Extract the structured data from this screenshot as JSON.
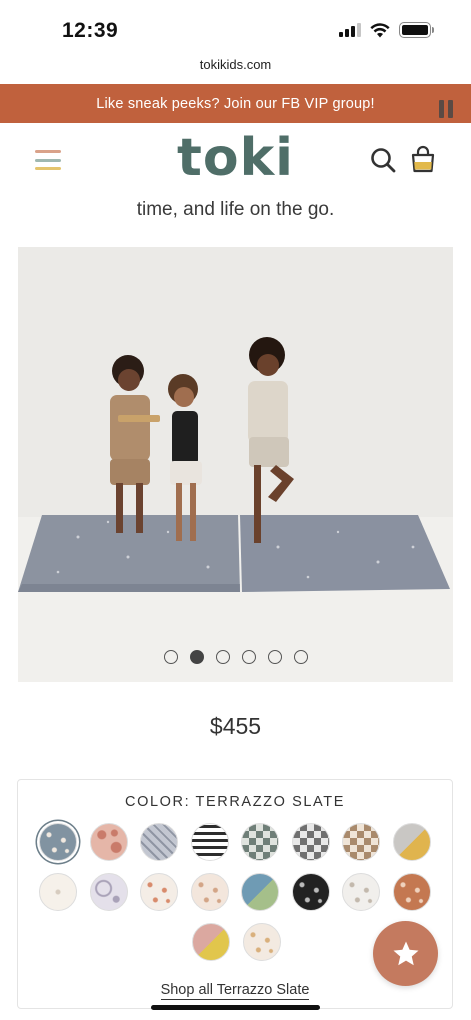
{
  "status": {
    "time": "12:39"
  },
  "browser": {
    "url": "tokikids.com"
  },
  "promo": {
    "text": "Like sneak peeks? Join our FB VIP group!"
  },
  "header": {
    "logo": "toki"
  },
  "tagline": "time, and life on the go.",
  "carousel": {
    "slide_count": 6,
    "active_index": 1
  },
  "product": {
    "price": "$455"
  },
  "color_panel": {
    "heading": "COLOR: TERRAZZO SLATE",
    "selected_index": 0,
    "shop_link": "Shop all Terrazzo Slate",
    "swatches": [
      [
        "#8193a1",
        "#f0e8df",
        "dots"
      ],
      [
        "#e5b6a8",
        "#c97b6a",
        "floral"
      ],
      [
        "#c3c7d1",
        "#8f95a3",
        "diamond"
      ],
      [
        "#ffffff",
        "#2d2d2d",
        "stripes"
      ],
      [
        "#dfe3de",
        "#6f7f78",
        "check"
      ],
      [
        "#e8e8e8",
        "#707070",
        "check"
      ],
      [
        "#efe4d7",
        "#a98a6c",
        "check"
      ],
      [
        "#c9c7c4",
        "#e0b44e",
        "split"
      ],
      [
        "#f6f1ea",
        "#d7ccbf",
        "plain"
      ],
      [
        "#e4e0ea",
        "#a9a2b8",
        "peace"
      ],
      [
        "#f4ede6",
        "#d88b6c",
        "dots"
      ],
      [
        "#f3e6dc",
        "#d3a587",
        "dots"
      ],
      [
        "#6f9bb4",
        "#a5bf8a",
        "split"
      ],
      [
        "#222222",
        "#bbbbbb",
        "dots"
      ],
      [
        "#f1efec",
        "#c3b9ad",
        "dots"
      ],
      [
        "#c47851",
        "#efd2bd",
        "dots"
      ],
      [
        "#dba8a0",
        "#e1c64c",
        "split"
      ],
      [
        "#f3eae1",
        "#d9b07c",
        "dots"
      ]
    ]
  },
  "colors": {
    "accent": "#c0613d",
    "logo": "#4f6e68",
    "fab": "#c47a5f"
  },
  "icons": [
    "signal-icon",
    "wifi-icon",
    "battery-icon",
    "menu-icon",
    "search-icon",
    "bag-icon",
    "pause-icon",
    "star-icon"
  ]
}
